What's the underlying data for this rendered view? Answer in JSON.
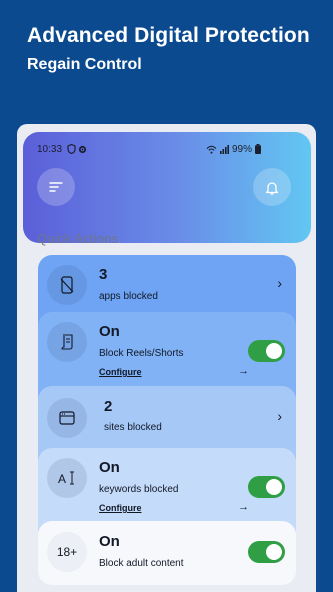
{
  "hero": {
    "title": "Advanced Digital Protection",
    "subtitle": "Regain Control"
  },
  "statusbar": {
    "time": "10:33",
    "battery": "99%"
  },
  "quick_actions": {
    "title": "Quick Actions",
    "apps": {
      "count": "3",
      "label": "apps blocked"
    },
    "reels": {
      "status": "On",
      "label": "Block Reels/Shorts",
      "configure": "Configure",
      "enabled": true
    },
    "sites": {
      "count": "2",
      "label": "sites blocked"
    },
    "keywords": {
      "status": "On",
      "label": "keywords blocked",
      "configure": "Configure",
      "enabled": true
    },
    "adult": {
      "status": "On",
      "label": "Block adult content",
      "icon_text": "18+",
      "enabled": true
    }
  },
  "colors": {
    "background": "#0c4a8f",
    "toggle_on": "#2f9e44",
    "header_start": "#5b5fd9",
    "header_end": "#62c7f2"
  }
}
